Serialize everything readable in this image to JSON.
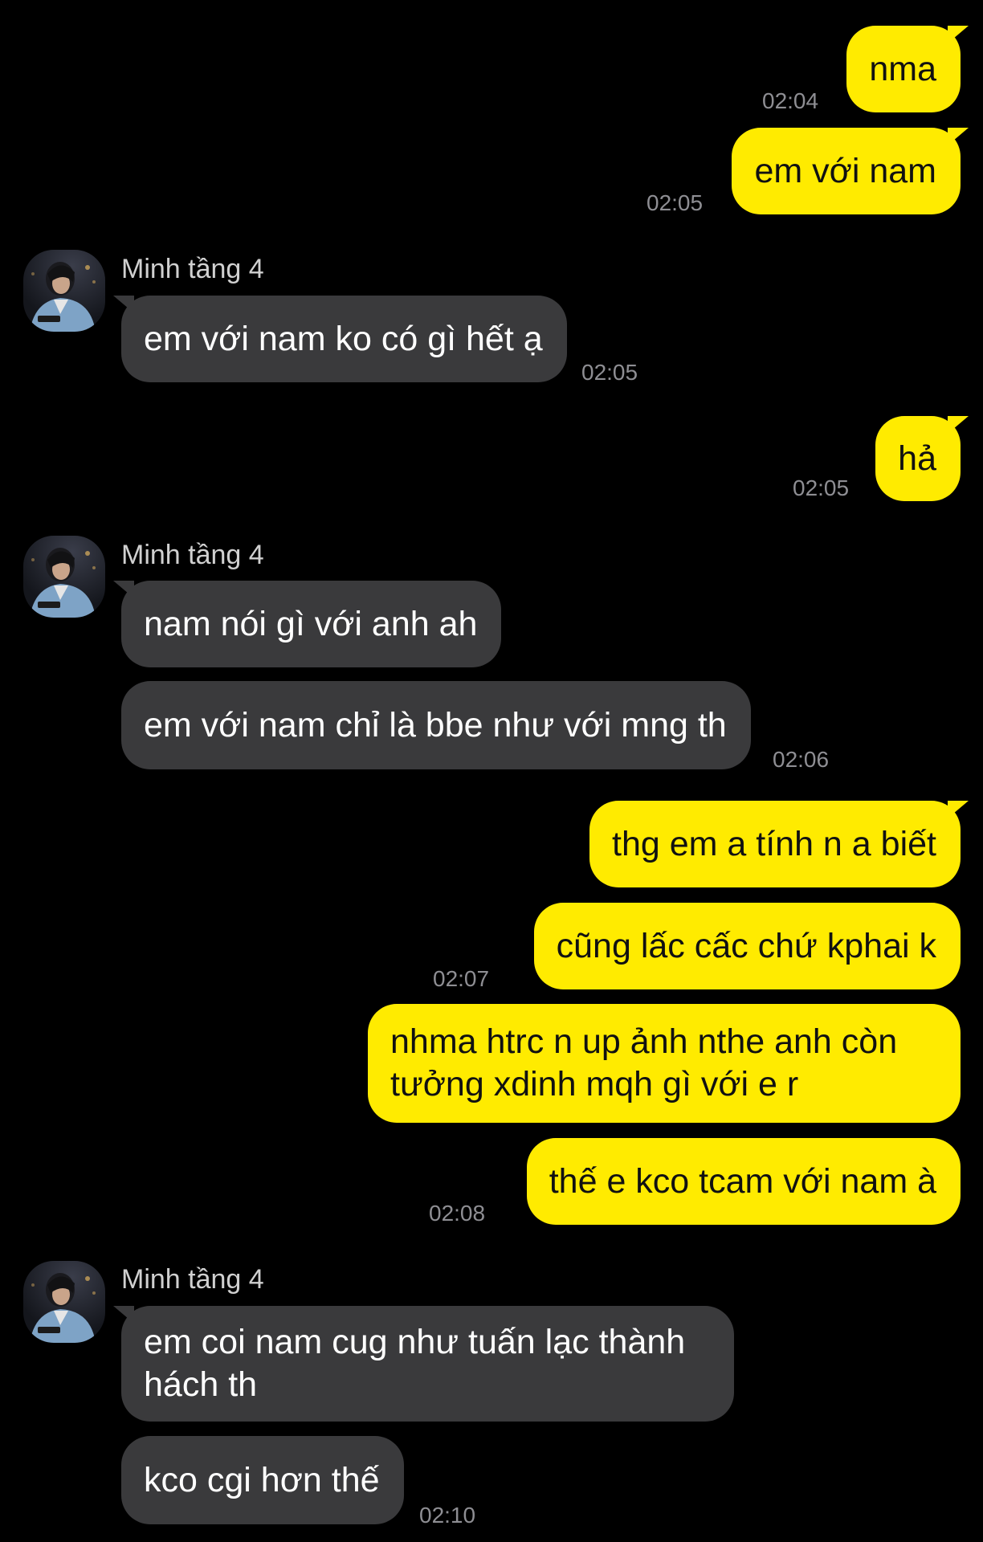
{
  "contact": {
    "name": "Minh tầng 4",
    "avatar_icon": "contact-avatar-photo"
  },
  "colors": {
    "background": "#000000",
    "outgoing": "#ffeb00",
    "incoming": "#3a3a3c",
    "timestamp": "#8e8e93"
  },
  "messages": [
    {
      "dir": "out",
      "text": "nma",
      "time": "02:04"
    },
    {
      "dir": "out",
      "text": "em với nam",
      "time": "02:05"
    },
    {
      "dir": "in",
      "text": "em với nam ko có gì hết ạ",
      "time": "02:05"
    },
    {
      "dir": "out",
      "text": "hả",
      "time": "02:05"
    },
    {
      "dir": "in",
      "text": "nam nói gì với anh ah"
    },
    {
      "dir": "in",
      "text": "em với nam chỉ là bbe như với mng th",
      "time": "02:06"
    },
    {
      "dir": "out",
      "text": "thg em a tính n a biết"
    },
    {
      "dir": "out",
      "text": "cũng lấc cấc chứ kphai k",
      "time": "02:07"
    },
    {
      "dir": "out",
      "text": "nhma htrc n up ảnh nthe anh còn tưởng xdinh mqh gì với e r"
    },
    {
      "dir": "out",
      "text": "thế e kco tcam với nam à",
      "time": "02:08"
    },
    {
      "dir": "in",
      "text": "em coi nam cug như tuấn lạc thành hách th"
    },
    {
      "dir": "in",
      "text": "kco cgi hơn thế",
      "time": "02:10"
    }
  ]
}
